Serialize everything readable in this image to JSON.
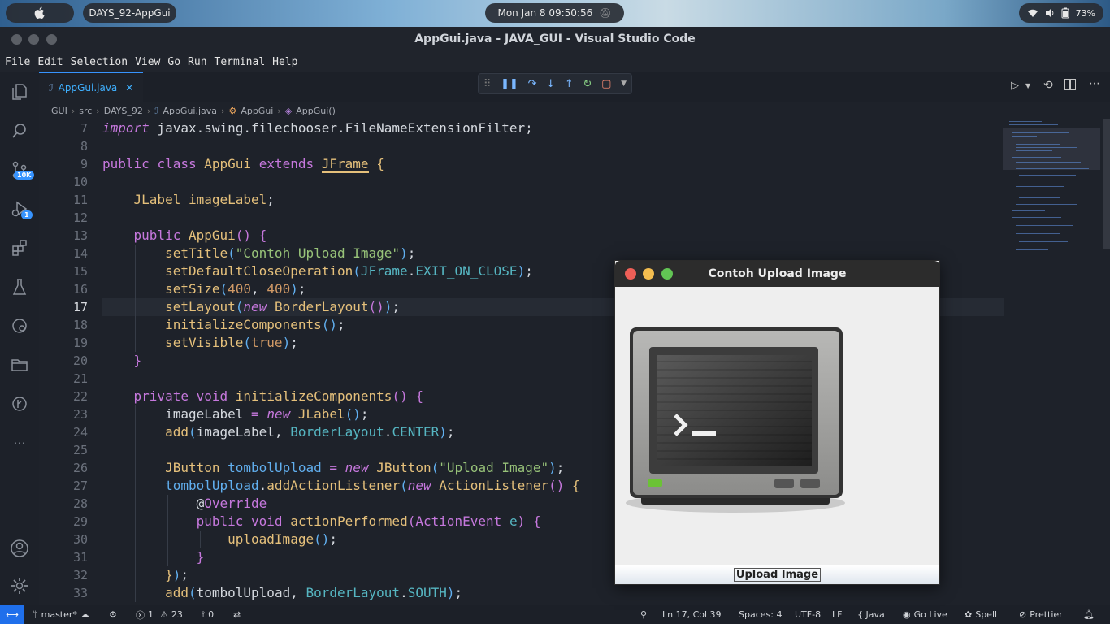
{
  "system_bar": {
    "app_name": "DAYS_92-AppGui",
    "clock": "Mon Jan 8  09:50:56",
    "battery": "73%"
  },
  "window": {
    "title": "AppGui.java - JAVA_GUI - Visual Studio Code"
  },
  "menu": [
    "File",
    "Edit",
    "Selection",
    "View",
    "Go",
    "Run",
    "Terminal",
    "Help"
  ],
  "activity_bar": {
    "source_control_badge": "10K",
    "run_debug_badge": "1"
  },
  "editor": {
    "tab_label": "AppGui.java",
    "breadcrumb": [
      "GUI",
      "src",
      "DAYS_92",
      "AppGui.java",
      "AppGui",
      "AppGui()"
    ],
    "line_numbers": [
      "7",
      "8",
      "9",
      "10",
      "11",
      "12",
      "13",
      "14",
      "15",
      "16",
      "17",
      "18",
      "19",
      "20",
      "21",
      "22",
      "23",
      "24",
      "25",
      "26",
      "27",
      "28",
      "29",
      "30",
      "31",
      "32",
      "33"
    ],
    "current_line": "17"
  },
  "status_bar": {
    "branch": "master*",
    "errors": "1",
    "warnings": "23",
    "ports": "0",
    "cursor": "Ln 17, Col 39",
    "spaces": "Spaces: 4",
    "encoding": "UTF-8",
    "eol": "LF",
    "language": "{ Java",
    "go_live": "Go Live",
    "spell": "Spell",
    "prettier": "Prettier"
  },
  "java_window": {
    "title": "Contoh Upload Image",
    "button_label": "Upload Image"
  },
  "colors": {
    "accent": "#3794ff",
    "keyword": "#c678dd",
    "type": "#e5c07b",
    "function": "#61afef",
    "string": "#98c379",
    "number": "#d19a66"
  }
}
